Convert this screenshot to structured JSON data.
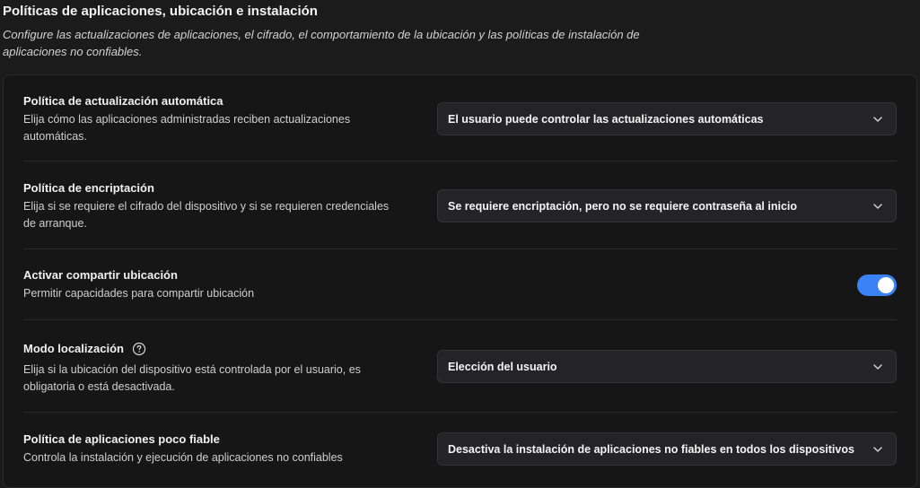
{
  "header": {
    "title": "Políticas de aplicaciones, ubicación e instalación",
    "description": "Configure las actualizaciones de aplicaciones, el cifrado, el comportamiento de la ubicación y las políticas de instalación de aplicaciones no confiables."
  },
  "settings": {
    "auto_update": {
      "label": "Política de actualización automática",
      "description": "Elija cómo las aplicaciones administradas reciben actualizaciones automáticas.",
      "selected": "El usuario puede controlar las actualizaciones automáticas",
      "icon": "chevron-down-icon"
    },
    "encryption": {
      "label": "Política de encriptación",
      "description": "Elija si se requiere el cifrado del dispositivo y si se requieren credenciales de arranque.",
      "selected": "Se requiere encriptación, pero no se requiere contraseña al inicio",
      "icon": "chevron-down-icon"
    },
    "location_sharing": {
      "label": "Activar compartir ubicación",
      "description": "Permitir capacidades para compartir ubicación",
      "enabled": true,
      "track_color": "#3b82f6"
    },
    "location_mode": {
      "label": "Modo localización",
      "help_icon": "question-circle-icon",
      "description": "Elija si la ubicación del dispositivo está controlada por el usuario, es obligatoria o está desactivada.",
      "selected": "Elección del usuario",
      "icon": "chevron-down-icon"
    },
    "untrusted_apps": {
      "label": "Política de aplicaciones poco fiable",
      "description": "Controla la instalación y ejecución de aplicaciones no confiables",
      "selected": "Desactiva la instalación de aplicaciones no fiables en todos los dispositivos",
      "icon": "chevron-down-icon"
    }
  }
}
